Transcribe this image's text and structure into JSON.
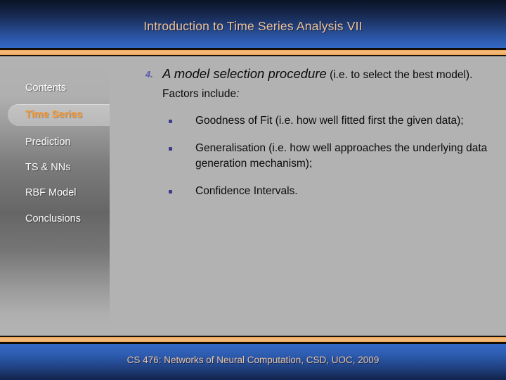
{
  "header": {
    "title": "Introduction to Time Series Analysis VII",
    "title_color": "#f0c39a",
    "accent_color": "#f0a85c"
  },
  "sidebar": {
    "items": [
      {
        "label": "Contents",
        "active": false
      },
      {
        "label": "Time Series",
        "active": true
      },
      {
        "label": "Prediction",
        "active": false
      },
      {
        "label": "TS & NNs",
        "active": false
      },
      {
        "label": "RBF Model",
        "active": false
      },
      {
        "label": "Conclusions",
        "active": false
      }
    ],
    "active_color": "#f79a34",
    "label_color": "#ffffff"
  },
  "main": {
    "lead": {
      "number": "4.",
      "number_color": "#5b5ba8",
      "emphasis": "A model selection procedure",
      "rest": " (i.e. to select the best model). Factors include",
      "colon": ":"
    },
    "bullets": [
      {
        "text": "Goodness of Fit (i.e. how well fitted first the given data);"
      },
      {
        "text": "Generalisation (i.e. how well approaches the underlying data generation mechanism);"
      },
      {
        "text": "Confidence Intervals."
      }
    ],
    "bullet_marker_color": "#3b3b8e"
  },
  "footer": {
    "text": "CS 476: Networks of Neural Computation, CSD, UOC, 2009",
    "text_color": "#e9c4a6"
  }
}
